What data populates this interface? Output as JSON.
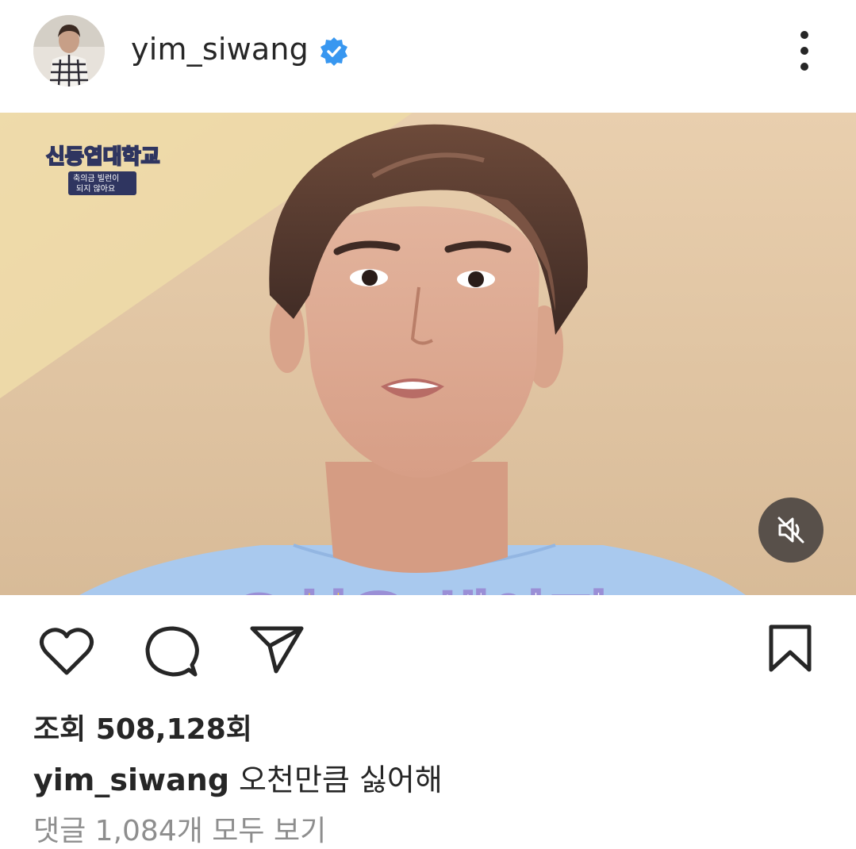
{
  "post": {
    "username": "yim_siwang",
    "verified": true,
    "video_caption_yellow": "오천",
    "video_caption_white": "은 해야지",
    "show_logo_line1": "신동엽대학교",
    "show_logo_line2": "축의금 빌런이",
    "show_logo_line3": "되지 않아요",
    "muted": true
  },
  "stats": {
    "views": "조회 508,128회"
  },
  "caption": {
    "username": "yim_siwang",
    "text": "오천만큼 싫어해"
  },
  "comments": {
    "view_all": "댓글 1,084개 모두 보기"
  },
  "icons": {
    "more": "more-vertical-icon",
    "verified": "verified-badge-icon",
    "mute": "volume-off-icon",
    "like": "heart-icon",
    "comment": "comment-icon",
    "share": "send-icon",
    "save": "bookmark-icon"
  },
  "colors": {
    "verified_blue": "#3897f0",
    "text": "#262626",
    "secondary_text": "#8e8e8e"
  }
}
